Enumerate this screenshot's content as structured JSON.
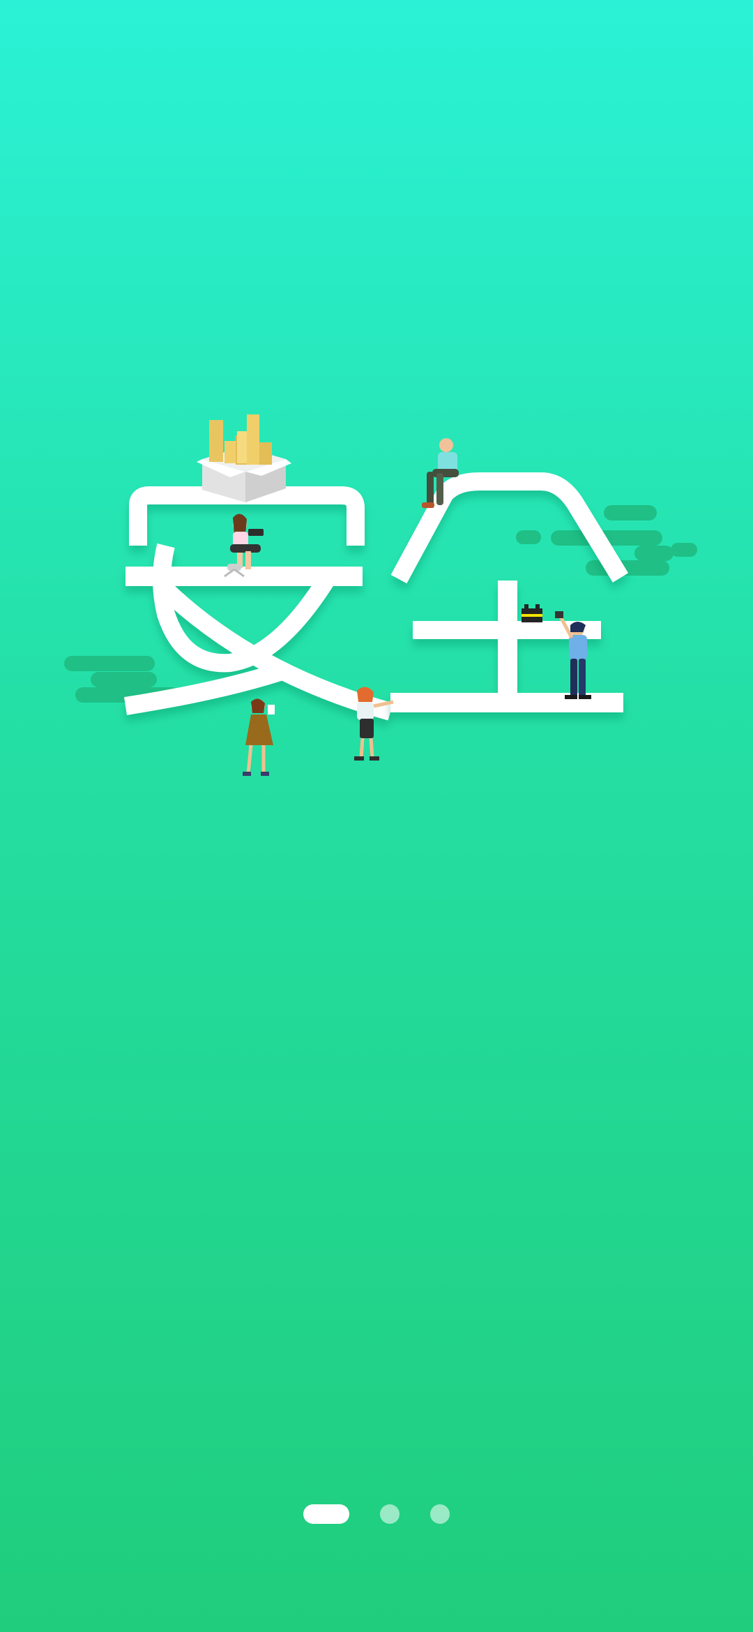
{
  "hero": {
    "characters": "安全"
  },
  "pager": {
    "total": 3,
    "active_index": 0
  },
  "colors": {
    "background_top": "#2bf2d6",
    "background_bottom": "#20cd7c",
    "cloud": "#1fbf86",
    "stroke": "#ffffff",
    "pager_active": "#ffffff",
    "pager_inactive": "#ffffffa0"
  }
}
